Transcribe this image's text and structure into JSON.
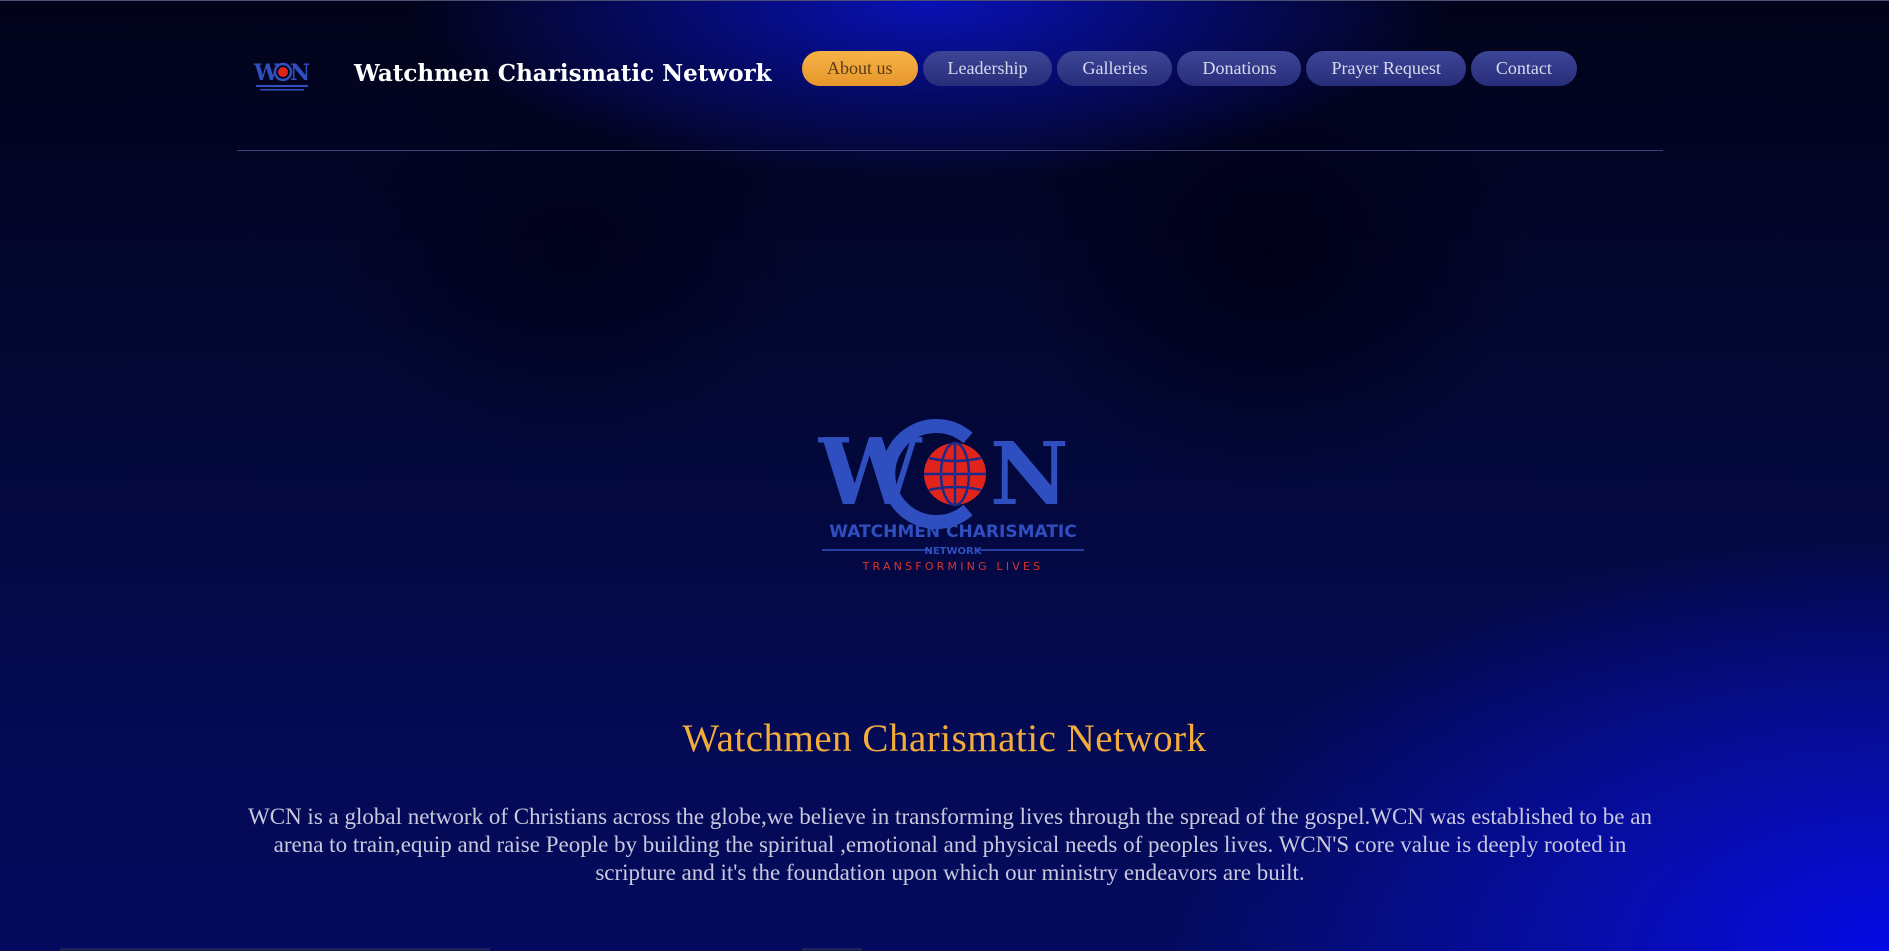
{
  "header": {
    "logo_icon": "wcn-logo-icon",
    "site_title": "Watchmen Charismatic Network"
  },
  "nav": {
    "items": [
      {
        "label": "About us",
        "active": true
      },
      {
        "label": "Leadership",
        "active": false
      },
      {
        "label": "Galleries",
        "active": false
      },
      {
        "label": "Donations",
        "active": false
      },
      {
        "label": "Prayer Request",
        "active": false
      },
      {
        "label": "Contact",
        "active": false
      }
    ]
  },
  "hero": {
    "logo": {
      "monogram": "WCN",
      "name_line": "WATCHMEN CHARISMATIC",
      "network_line": "NETWORK",
      "tagline": "TRANSFORMING LIVES"
    },
    "title": "Watchmen Charismatic Network",
    "description": "WCN is a global network of Christians across the globe,we believe in transforming lives through the spread of the gospel.WCN was established to be an arena to train,equip and raise People by building the spiritual ,emotional and physical needs of peoples lives. WCN'S core value is deeply rooted in scripture and it's the foundation upon which our ministry endeavors are built."
  },
  "colors": {
    "accent": "#f3ac3c",
    "nav_active": "#eda23a",
    "nav_default": "#2f3684",
    "logo_blue": "#2f4fc0",
    "logo_red": "#e0241c"
  }
}
